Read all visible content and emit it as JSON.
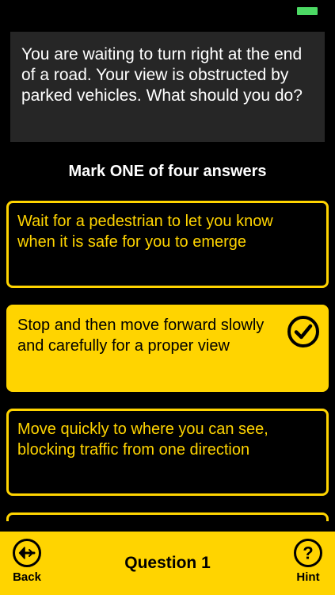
{
  "question": {
    "text": "You are waiting to turn right at the end of a road. Your view is obstructed by parked vehicles. What should you do?"
  },
  "instruction": "Mark ONE of four answers",
  "answers": [
    {
      "text": "Wait for a pedestrian to let you know when it is safe for you to emerge",
      "selected": false
    },
    {
      "text": "Stop and then move forward slowly and carefully for a proper view",
      "selected": true
    },
    {
      "text": "Move quickly to where you can see, blocking traffic from one direction",
      "selected": false
    },
    {
      "text": "",
      "selected": false
    }
  ],
  "footer": {
    "back_label": "Back",
    "title": "Question 1",
    "hint_label": "Hint"
  },
  "colors": {
    "accent": "#ffd400",
    "background": "#000000",
    "question_box": "#262626",
    "battery": "#4cd964"
  },
  "icons": {
    "battery": "battery-icon",
    "check": "check-circle-icon",
    "back": "back-arrow-icon",
    "hint": "question-mark-icon"
  }
}
